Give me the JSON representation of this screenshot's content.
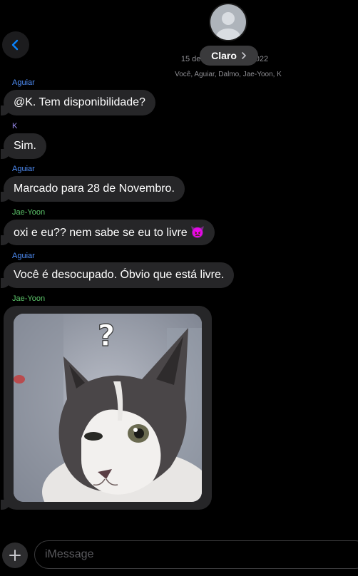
{
  "header": {
    "contact_name": "Claro",
    "date": "15 de novembro de 2022",
    "participants": "Você, Aguiar, Dalmo, Jae-Yoon, K",
    "icons": {
      "back": "chevron-left-icon",
      "contact_chevron": "chevron-right-icon",
      "avatar": "person-icon"
    }
  },
  "colors": {
    "accent": "#0a84ff",
    "sender_aguiar": "#4f8ef7",
    "sender_k": "#9b8cf0",
    "sender_jaeyoon": "#5cc46a",
    "bubble": "#262628"
  },
  "messages": [
    {
      "sender": "Aguiar",
      "text": "@K. Tem disponibilidade?"
    },
    {
      "sender": "K",
      "text": "Sim."
    },
    {
      "sender": "Aguiar",
      "text": "Marcado para 28 de Novembro."
    },
    {
      "sender": "Jae-Yoon",
      "text": "oxi e eu?? nem sabe se eu to livre 👿"
    },
    {
      "sender": "Aguiar",
      "text": "Você é desocupado. Óbvio que está livre."
    },
    {
      "sender": "Jae-Yoon",
      "image": "confused-cat-with-question-mark"
    }
  ],
  "composer": {
    "placeholder": "iMessage",
    "plus_icon": "plus-icon"
  }
}
